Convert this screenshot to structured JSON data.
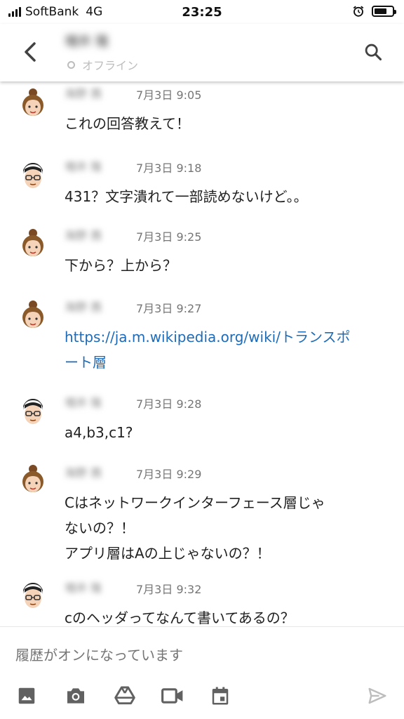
{
  "status_bar": {
    "carrier": "SoftBank",
    "network": "4G",
    "time": "23:25"
  },
  "header": {
    "contact_name": "増井 隆",
    "presence": "オフライン"
  },
  "messages": [
    {
      "avatar": "female-avatar",
      "sender": "海野 茜",
      "time": "7月3日 9:05",
      "text": "これの回答教えて！"
    },
    {
      "avatar": "male-avatar",
      "sender": "増井 隆",
      "time": "7月3日 9:18",
      "text": "431？文字潰れて一部読めないけど。。"
    },
    {
      "avatar": "female-avatar",
      "sender": "海野 茜",
      "time": "7月3日 9:25",
      "text": "下から？上から？"
    },
    {
      "avatar": "female-avatar",
      "sender": "海野 茜",
      "time": "7月3日 9:27",
      "text": "https://ja.m.wikipedia.org/wiki/トランスポート層"
    },
    {
      "avatar": "male-avatar",
      "sender": "増井 隆",
      "time": "7月3日 9:28",
      "text": "a4,b3,c1?"
    },
    {
      "avatar": "female-avatar",
      "sender": "海野 茜",
      "time": "7月3日 9:29",
      "text": "Cはネットワークインターフェース層じゃ\nないの？！\nアプリ層はAの上じゃないの？！"
    },
    {
      "avatar": "male-avatar",
      "sender": "増井 隆",
      "time": "7月3日 9:32",
      "text": "cのヘッダってなんて書いてあるの？"
    }
  ],
  "composer": {
    "placeholder": "履歴がオンになっています"
  },
  "colors": {
    "link": "#1e6bb8",
    "icon": "#616161",
    "send_icon": "#bdbdbd"
  }
}
